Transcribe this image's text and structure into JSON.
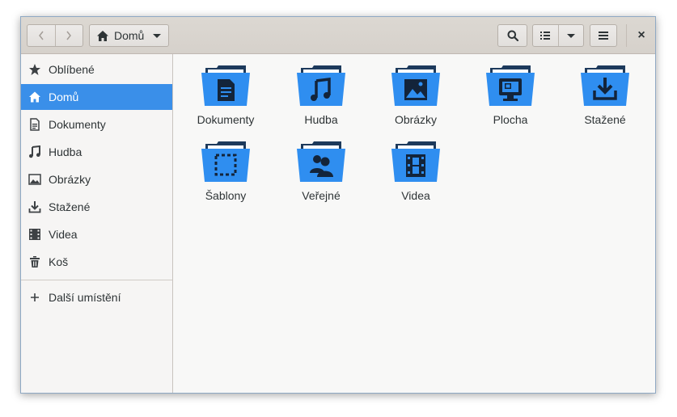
{
  "header": {
    "back_icon": "chevron-left-icon",
    "forward_icon": "chevron-right-icon",
    "path_label": "Domů",
    "close_glyph": "×"
  },
  "sidebar": {
    "items": [
      {
        "label": "Oblíbené",
        "icon": "star-icon"
      },
      {
        "label": "Domů",
        "icon": "home-icon",
        "active": true
      },
      {
        "label": "Dokumenty",
        "icon": "document-icon"
      },
      {
        "label": "Hudba",
        "icon": "music-icon"
      },
      {
        "label": "Obrázky",
        "icon": "image-icon"
      },
      {
        "label": "Stažené",
        "icon": "download-icon"
      },
      {
        "label": "Videa",
        "icon": "film-icon"
      },
      {
        "label": "Koš",
        "icon": "trash-icon"
      }
    ],
    "other_locations": {
      "label": "Další umístění",
      "icon": "plus-icon"
    }
  },
  "folders": [
    {
      "label": "Dokumenty",
      "icon": "document-icon"
    },
    {
      "label": "Hudba",
      "icon": "music-icon"
    },
    {
      "label": "Obrázky",
      "icon": "image-icon"
    },
    {
      "label": "Plocha",
      "icon": "desktop-icon"
    },
    {
      "label": "Stažené",
      "icon": "download-icon"
    },
    {
      "label": "Šablony",
      "icon": "template-icon"
    },
    {
      "label": "Veřejné",
      "icon": "users-icon"
    },
    {
      "label": "Videa",
      "icon": "film-icon"
    }
  ],
  "colors": {
    "accent": "#3a8fe9",
    "folder_front": "#2f8ef0",
    "folder_dark": "#1d3a5c"
  }
}
